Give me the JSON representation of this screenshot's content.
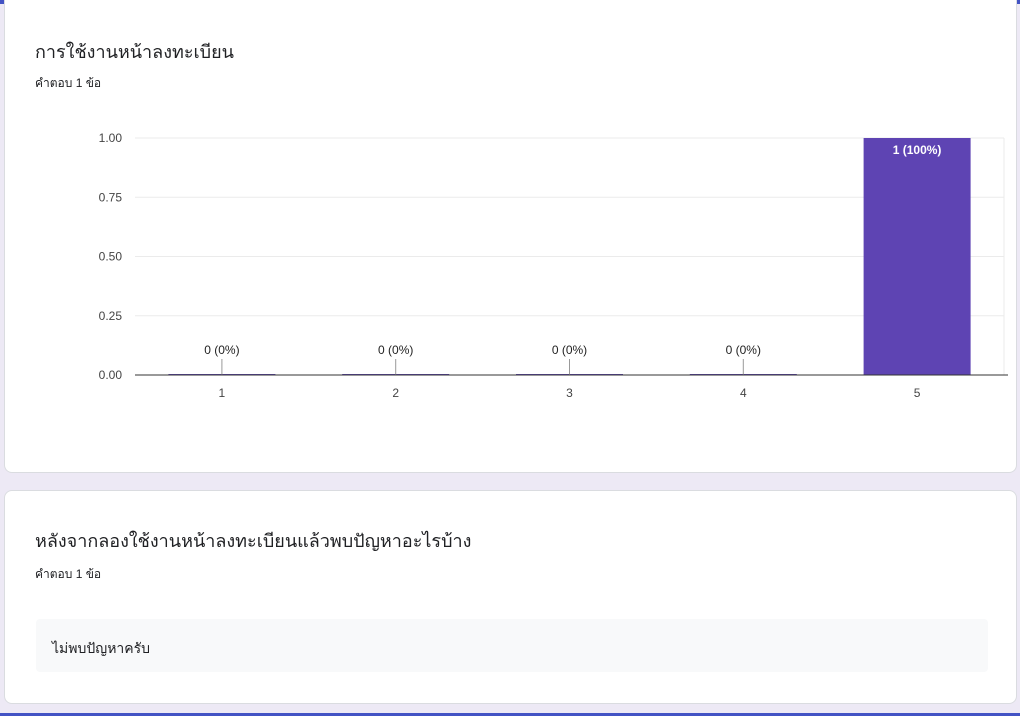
{
  "questions": [
    {
      "title": "การใช้งานหน้าลงทะเบียน",
      "response_count": "คำตอบ 1 ข้อ"
    },
    {
      "title": "หลังจากลองใช้งานหน้าลงทะเบียนแล้วพบปัญหาอะไรบ้าง",
      "response_count": "คำตอบ 1 ข้อ",
      "answers": [
        "ไม่พบปัญหาครับ"
      ]
    }
  ],
  "colors": {
    "bar": "#5e44b3",
    "accent": "#4353c4",
    "background": "#ede9f5"
  },
  "chart_data": {
    "type": "bar",
    "categories": [
      "1",
      "2",
      "3",
      "4",
      "5"
    ],
    "values": [
      0,
      0,
      0,
      0,
      1
    ],
    "data_labels": [
      "0 (0%)",
      "0 (0%)",
      "0 (0%)",
      "0 (0%)",
      "1 (100%)"
    ],
    "yticks": [
      "0.00",
      "0.25",
      "0.50",
      "0.75",
      "1.00"
    ],
    "ylim": [
      0,
      1
    ],
    "grid": true,
    "legend": "none"
  }
}
